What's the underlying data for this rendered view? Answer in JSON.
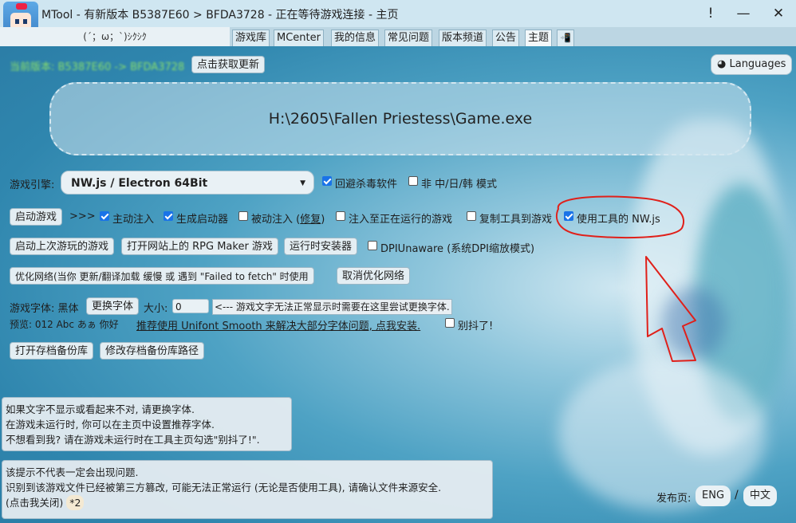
{
  "window": {
    "title": "MTool - 有新版本 B5387E60 > BFDA3728 - 正在等待游戏连接 - 主页",
    "alert_glyph": "!",
    "minimize_glyph": "—",
    "close_glyph": "✕"
  },
  "status_kaomoji": "(´；ω；`)ｼｸｼｸ",
  "tabs": [
    "游戏库",
    "MCenter",
    "我的信息",
    "常见问题",
    "版本频道",
    "公告",
    "主题",
    "📲"
  ],
  "update": {
    "version_text": "当前版本: B5387E60 -> BFDA3728",
    "get_update_button": "点击获取更新"
  },
  "languages_button": "Languages",
  "game_path": "H:\\2605\\Fallen Priestess\\Game.exe",
  "engine": {
    "label": "游戏引擎:",
    "value": "NW.js / Electron 64Bit"
  },
  "engine_options": [
    {
      "label": "回避杀毒软件",
      "checked": true
    },
    {
      "label": "非 中/日/韩 模式",
      "checked": false
    }
  ],
  "launch": {
    "start_button": "启动游戏",
    "arrows": ">>>",
    "options": [
      {
        "label": "主动注入",
        "checked": true
      },
      {
        "label": "生成启动器",
        "checked": true
      },
      {
        "label_prefix": "被动注入 (",
        "label_link": "修复",
        "label_suffix": ")",
        "checked": false
      },
      {
        "label": "注入至正在运行的游戏",
        "checked": false
      },
      {
        "label": "复制工具到游戏",
        "checked": false
      },
      {
        "label": "使用工具的 NW.js",
        "checked": true
      }
    ]
  },
  "row3": {
    "last_game_button": "启动上次游玩的游戏",
    "rpg_site_button": "打开网站上的 RPG Maker 游戏",
    "runtime_installer_button": "运行时安装器",
    "dpi_option": {
      "label": "DPIUnaware (系统DPI缩放模式)",
      "checked": false
    }
  },
  "network": {
    "optimize_button": "优化网络(当你 更新/翻译加载 缓慢 或 遇到 \"Failed to fetch\" 时使用",
    "cancel_button": "取消优化网络"
  },
  "font": {
    "label": "游戏字体: 黑体",
    "change_button": "更换字体",
    "size_label": "大小:",
    "size_value": "0",
    "hint": "<--- 游戏文字无法正常显示时需要在这里尝试更换字体.",
    "preview_label": "预览: 012 Abc あぁ 你好",
    "recommend_link": "推荐使用 Unifont Smooth 来解决大部分字体问题, 点我安装.",
    "shake_option": {
      "label": "别抖了!",
      "checked": false
    }
  },
  "saves": {
    "open_backup_button": "打开存档备份库",
    "modify_path_button": "修改存档备份库路径"
  },
  "notice1": {
    "lines": [
      "如果文字不显示或看起来不对, 请更换字体.",
      "在游戏未运行时, 你可以在主页中设置推荐字体.",
      "不想看到我? 请在游戏未运行时在工具主页勾选\"别抖了!\"."
    ]
  },
  "notice2": {
    "lines": [
      "该提示不代表一定会出现问题.",
      "识别到该游戏文件已经被第三方篡改, 可能无法正常运行 (无论是否使用工具), 请确认文件来源安全."
    ],
    "close_text": "(点击我关闭)",
    "badge": "*2"
  },
  "release": {
    "label": "发布页:",
    "eng": "ENG",
    "sep": "/",
    "zh": "中文"
  },
  "colors": {
    "annotation_red": "#e0201a",
    "update_green": "#8ce06a",
    "checkbox_blue": "#1a73e8"
  }
}
